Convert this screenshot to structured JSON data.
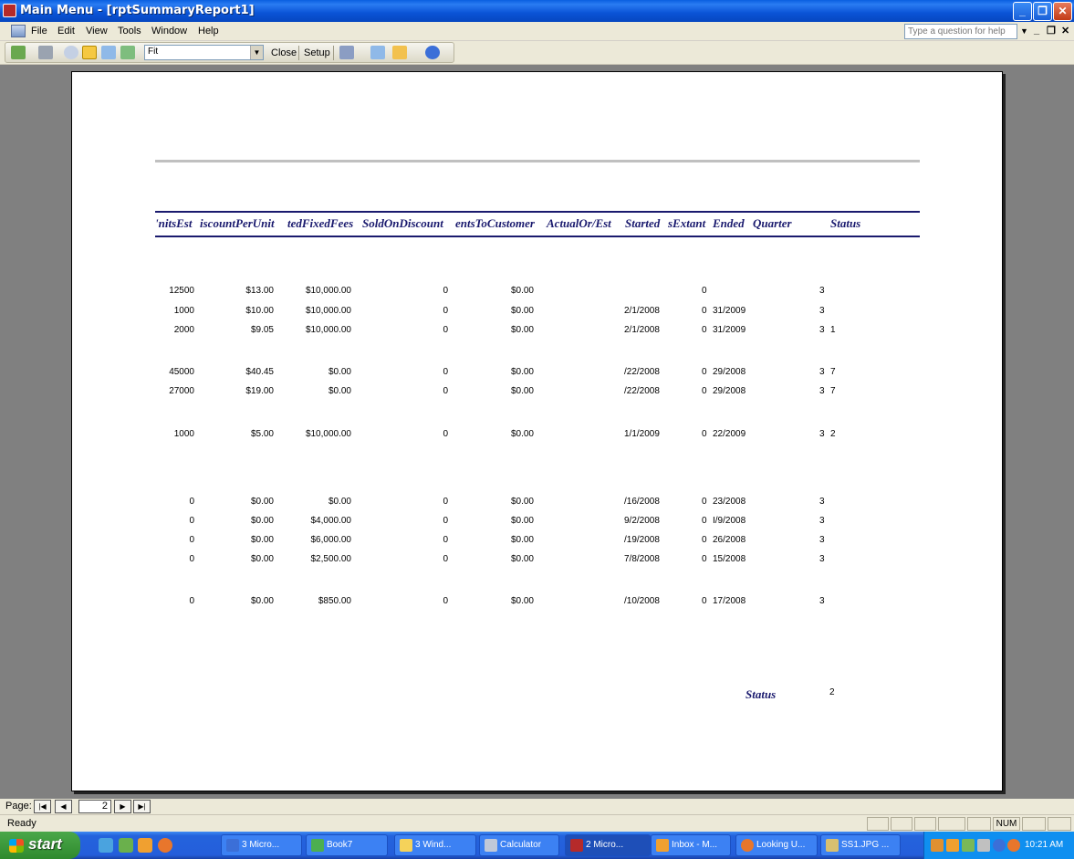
{
  "window": {
    "title": "Main Menu - [rptSummaryReport1]"
  },
  "menu": {
    "items": [
      "File",
      "Edit",
      "View",
      "Tools",
      "Window",
      "Help"
    ],
    "help_placeholder": "Type a question for help"
  },
  "toolbar": {
    "zoom": "Fit",
    "close_label": "Close",
    "setup_label": "Setup"
  },
  "report": {
    "columns": [
      "'nitsEst",
      "iscountPerUnit",
      "tedFixedFees",
      "SoldOnDiscount",
      "entsToCustomer",
      "ActualOr/Est",
      "Started",
      "sExtant",
      "Ended",
      "Quarter",
      "Status"
    ],
    "rows": [
      [
        "12500",
        "$13.00",
        "$10,000.00",
        "0",
        "$0.00",
        "",
        "0",
        "",
        "3",
        ""
      ],
      [
        "1000",
        "$10.00",
        "$10,000.00",
        "0",
        "$0.00",
        "2/1/2008",
        "0",
        "31/2009",
        "3",
        ""
      ],
      [
        "2000",
        "$9.05",
        "$10,000.00",
        "0",
        "$0.00",
        "2/1/2008",
        "0",
        "31/2009",
        "3",
        "1"
      ],
      [
        "45000",
        "$40.45",
        "$0.00",
        "0",
        "$0.00",
        "/22/2008",
        "0",
        "29/2008",
        "3",
        "7"
      ],
      [
        "27000",
        "$19.00",
        "$0.00",
        "0",
        "$0.00",
        "/22/2008",
        "0",
        "29/2008",
        "3",
        "7"
      ],
      [
        "1000",
        "$5.00",
        "$10,000.00",
        "0",
        "$0.00",
        "1/1/2009",
        "0",
        "22/2009",
        "3",
        "2"
      ],
      [
        "0",
        "$0.00",
        "$0.00",
        "0",
        "$0.00",
        "/16/2008",
        "0",
        "23/2008",
        "3",
        ""
      ],
      [
        "0",
        "$0.00",
        "$4,000.00",
        "0",
        "$0.00",
        "9/2/2008",
        "0",
        "I/9/2008",
        "3",
        ""
      ],
      [
        "0",
        "$0.00",
        "$6,000.00",
        "0",
        "$0.00",
        "/19/2008",
        "0",
        "26/2008",
        "3",
        ""
      ],
      [
        "0",
        "$0.00",
        "$2,500.00",
        "0",
        "$0.00",
        "7/8/2008",
        "0",
        "15/2008",
        "3",
        ""
      ],
      [
        "0",
        "$0.00",
        "$850.00",
        "0",
        "$0.00",
        "/10/2008",
        "0",
        "17/2008",
        "3",
        ""
      ]
    ],
    "footer_label": "Status",
    "footer_value": "2"
  },
  "pagenav": {
    "label": "Page:",
    "page": "2"
  },
  "status": {
    "text": "Ready",
    "num": "NUM"
  },
  "taskbar": {
    "start": "start",
    "tasks": [
      "3 Micro...",
      "Book7",
      "3 Wind...",
      "Calculator",
      "2 Micro...",
      "Inbox - M...",
      "Looking U...",
      "SS1.JPG ..."
    ],
    "clock": "10:21 AM"
  }
}
